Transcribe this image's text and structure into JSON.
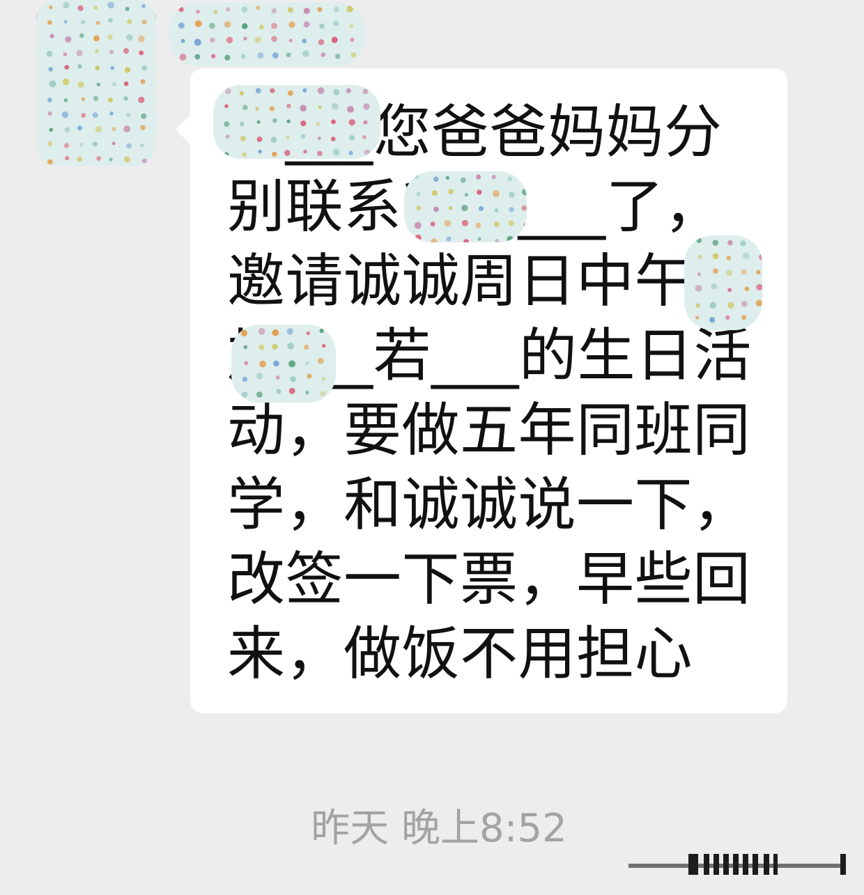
{
  "chat": {
    "sender_name": "",
    "message": "若___您爸爸妈妈分别联系我和___了，邀请诚诚周日中午参加___若___的生日活动，要做五年同班同学，和诚诚说一下，改签一下票，早些回来，做饭不用担心",
    "timestamp": "昨天 晚上8:52"
  },
  "icons": {
    "avatar": "avatar-icon",
    "redaction": "polka-dot-redaction"
  },
  "colors": {
    "background": "#ededed",
    "bubble": "#ffffff",
    "text": "#111111",
    "timestamp": "#a3a3a3",
    "redaction_base": "#ddeeed"
  }
}
